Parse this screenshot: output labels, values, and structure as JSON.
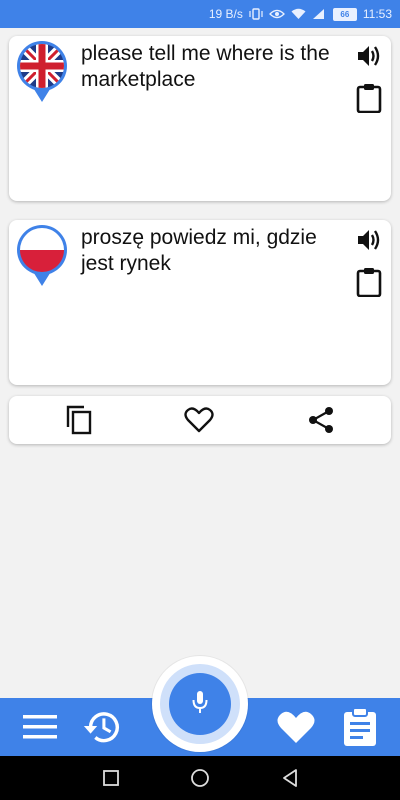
{
  "status_bar": {
    "net_speed": "19 B/s",
    "battery_level": "66",
    "time": "11:53"
  },
  "source": {
    "language_flag": "uk-flag-icon",
    "text": "please tell me where is the marketplace"
  },
  "target": {
    "language_flag": "poland-flag-icon",
    "text": "proszę powiedz mi, gdzie jest rynek"
  },
  "icons": {
    "speak": "speaker-icon",
    "clipboard": "clipboard-icon",
    "copy": "copy-icon",
    "favorite": "heart-icon",
    "share": "share-icon",
    "menu": "menu-icon",
    "history": "history-icon",
    "mic": "mic-icon",
    "favorites": "heart-icon",
    "phrasebook": "clipboard-list-icon"
  },
  "colors": {
    "primary": "#3f82e8",
    "background": "#f2f2f2"
  }
}
